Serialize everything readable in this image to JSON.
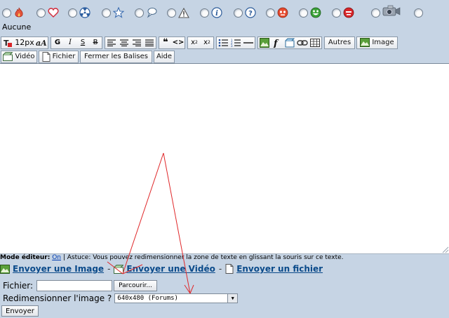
{
  "smileys": {
    "none_label": "Aucune",
    "icons": [
      "fire-icon",
      "heart-icon",
      "radiation-icon",
      "star-icon",
      "speech-bubble-icon",
      "warning-icon",
      "info-icon",
      "question-icon",
      "angry-face-icon",
      "grin-face-icon",
      "devil-face-icon",
      "camera-icon",
      "empty-icon"
    ]
  },
  "toolbar": {
    "font_size": "12px",
    "bold": "G",
    "italic": "I",
    "underline": "S",
    "strike": "B",
    "quote": "❝",
    "code": "<>",
    "subscript_base": "x",
    "subscript_mark": "2",
    "superscript_base": "x",
    "superscript_mark": "2",
    "more": "Autres",
    "image": "Image",
    "video": "Vidéo",
    "file": "Fichier",
    "close_tags": "Fermer les Balises",
    "help": "Aide"
  },
  "footer": {
    "mode_label": "Mode éditeur:",
    "mode_value": "On",
    "tip": "| Astuce: Vous pouvez redimensionner la zone de texte en glissant la souris sur ce texte.",
    "send_image": "Envoyer une Image",
    "send_video": "Envoyer une Vidéo",
    "send_file": "Envoyer un fichier",
    "sep": "-"
  },
  "upload_form": {
    "file_label": "Fichier:",
    "browse": "Parcourir...",
    "resize_label": "Redimensionner l'image ?",
    "resize_value": "640x480 (Forums)",
    "submit": "Envoyer"
  },
  "colors": {
    "background": "#c6d4e4",
    "annotation": "#e0282a",
    "link": "#0a4a8a"
  }
}
